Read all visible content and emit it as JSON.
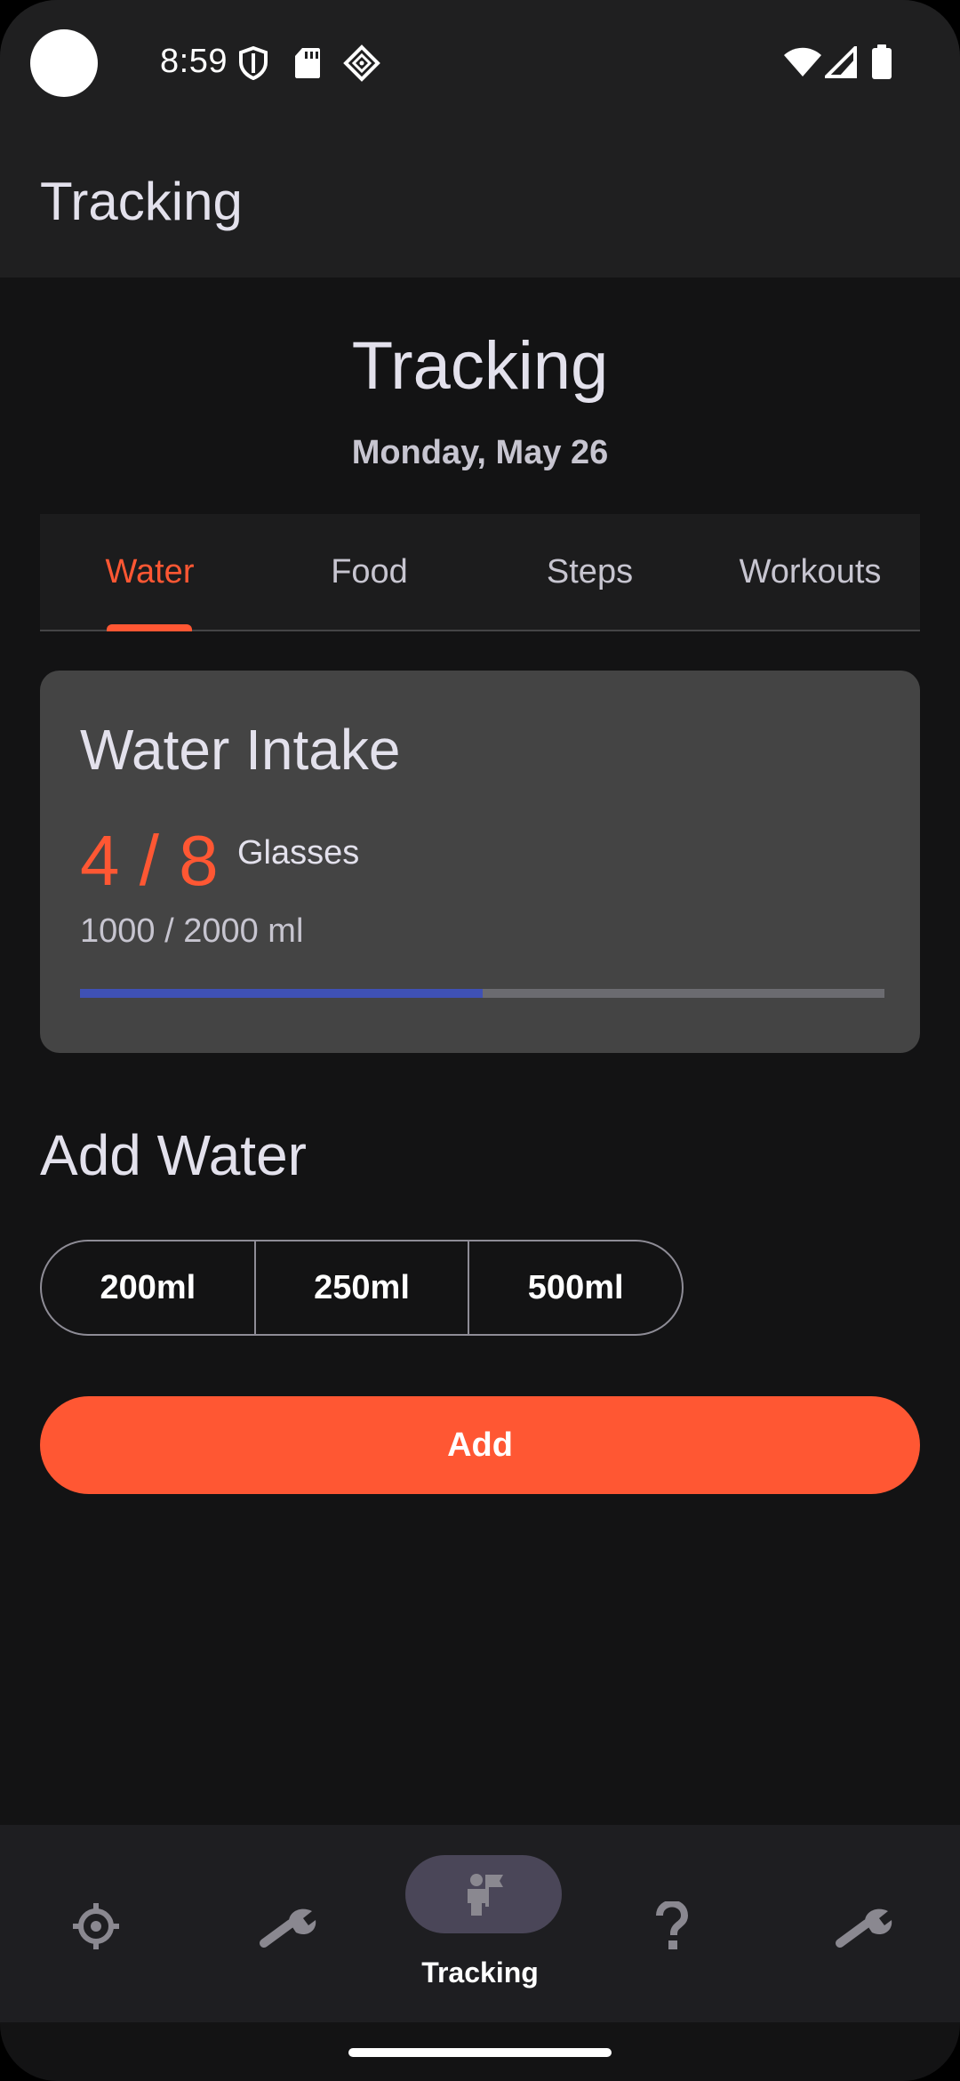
{
  "status_bar": {
    "time": "8:59",
    "left_icons": [
      "shield-icon",
      "sd-card-icon",
      "vpn-diamond-icon"
    ],
    "right_icons": [
      "wifi-icon",
      "signal-icon",
      "battery-icon"
    ]
  },
  "app_bar": {
    "title": "Tracking"
  },
  "header": {
    "title": "Tracking",
    "date": "Monday, May 26"
  },
  "tabs": [
    {
      "label": "Water",
      "active": true
    },
    {
      "label": "Food",
      "active": false
    },
    {
      "label": "Steps",
      "active": false
    },
    {
      "label": "Workouts",
      "active": false
    }
  ],
  "water_card": {
    "title": "Water Intake",
    "count": "4 / 8",
    "unit": "Glasses",
    "ml": "1000 / 2000 ml",
    "progress_fraction": 0.5
  },
  "add_water": {
    "title": "Add Water",
    "options": [
      "200ml",
      "250ml",
      "500ml"
    ],
    "add_label": "Add"
  },
  "bottom_nav": {
    "items": [
      {
        "icon": "crosshair-icon",
        "label": ""
      },
      {
        "icon": "wrench-icon",
        "label": ""
      },
      {
        "icon": "person-flag-icon",
        "label": "Tracking",
        "active": true
      },
      {
        "icon": "question-icon",
        "label": ""
      },
      {
        "icon": "wrench-icon",
        "label": ""
      }
    ]
  },
  "colors": {
    "accent": "#ff5733",
    "progress": "#3f51b5",
    "background": "#131314",
    "card": "#444444"
  }
}
